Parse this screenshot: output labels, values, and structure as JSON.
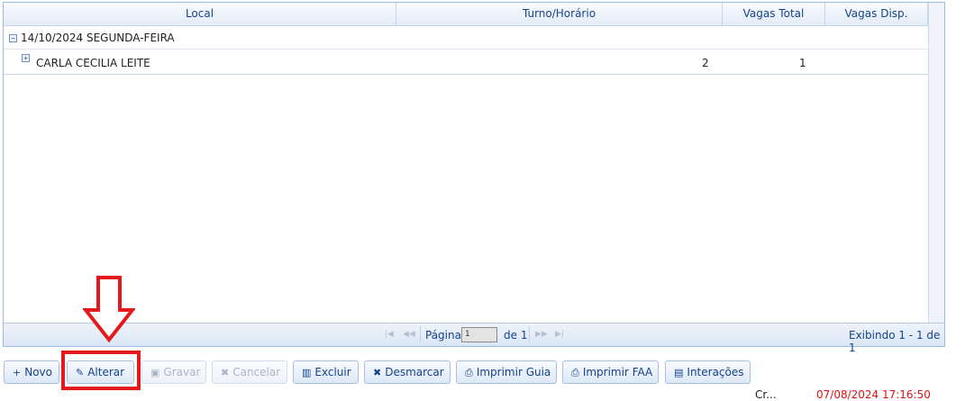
{
  "grid": {
    "columns": [
      "Local",
      "Turno/Horário",
      "Vagas Total",
      "Vagas Disp."
    ],
    "group": {
      "expander": "⊟",
      "label": "14/10/2024 SEGUNDA-FEIRA"
    },
    "rows": [
      {
        "expander": "⊞",
        "local": "CARLA CECILIA LEITE",
        "turno": "",
        "vagas_total": "2",
        "vagas_disp": "1"
      }
    ]
  },
  "pager": {
    "first_icon": "first-page-icon",
    "prev_icon": "prev-page-icon",
    "next_icon": "next-page-icon",
    "last_icon": "last-page-icon",
    "page_label": "Página",
    "page_value": "1",
    "of_label": "de 1",
    "display_info": "Exibindo 1 - 1 de 1"
  },
  "toolbar": {
    "novo": {
      "label": "Novo",
      "icon": "plus-icon",
      "glyph": "+"
    },
    "alterar": {
      "label": "Alterar",
      "icon": "pencil-icon",
      "glyph": "✎"
    },
    "gravar": {
      "label": "Gravar",
      "icon": "save-icon",
      "glyph": "▣"
    },
    "cancelar": {
      "label": "Cancelar",
      "icon": "cancel-icon",
      "glyph": "✖"
    },
    "excluir": {
      "label": "Excluir",
      "icon": "trash-icon",
      "glyph": "🗑"
    },
    "desmarcar": {
      "label": "Desmarcar",
      "icon": "x-icon",
      "glyph": "✖"
    },
    "imprimir_guia": {
      "label": "Imprimir Guia",
      "icon": "printer-icon",
      "glyph": "⎙"
    },
    "imprimir_faa": {
      "label": "Imprimir FAA",
      "icon": "printer-icon",
      "glyph": "⎙"
    },
    "interacoes": {
      "label": "Interações",
      "icon": "notebook-icon",
      "glyph": "▤"
    }
  },
  "status": {
    "label": "Cr...",
    "timestamp": "07/08/2024 17:16:50"
  },
  "colors": {
    "highlight": "#e3191b",
    "accent": "#15428b",
    "border": "#99bbe8"
  }
}
